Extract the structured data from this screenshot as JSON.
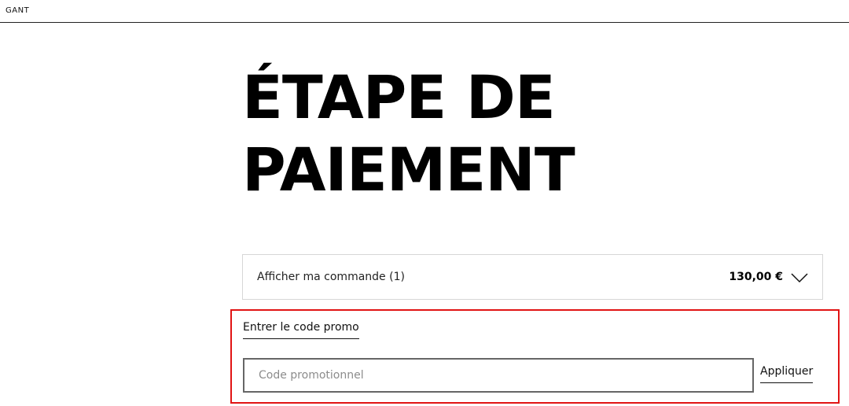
{
  "header": {
    "logo_text": "GANT"
  },
  "page": {
    "title_line1": "ÉTAPE DE",
    "title_line2": "PAIEMENT"
  },
  "order_summary": {
    "label": "Afficher ma commande (1)",
    "total": "130,00 €",
    "icon": "chevron-down-icon"
  },
  "promo": {
    "toggle_label": "Entrer le code promo",
    "input_value": "",
    "input_placeholder": "Code promotionnel",
    "apply_label": "Appliquer",
    "highlight_color": "#e11414"
  }
}
